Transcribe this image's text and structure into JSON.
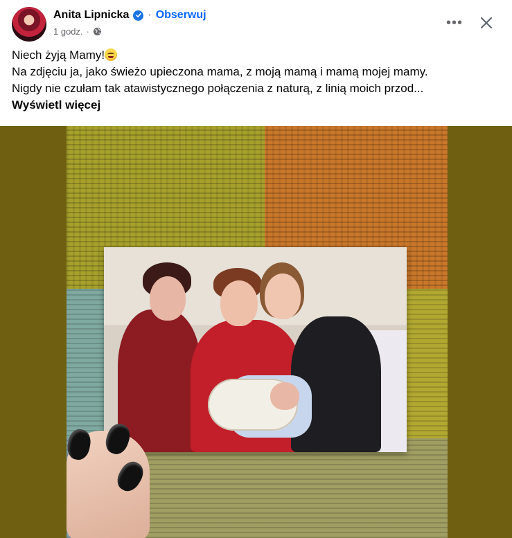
{
  "post": {
    "author": "Anita Lipnicka",
    "separator": "·",
    "follow_label": "Obserwuj",
    "timestamp": "1 godz.",
    "meta_separator": "·",
    "audience_icon": "globe-icon",
    "caption_lines": [
      "Niech żyją Mamy!",
      "Na zdjęciu ja, jako świeżo upieczona mama, z moją mamą i mamą mojej mamy.",
      "Nigdy nie czułam tak atawistycznego połączenia z naturą, z linią moich przod..."
    ],
    "see_more_label": "Wyświetl więcej"
  },
  "colors": {
    "accent_blue": "#0866ff",
    "verified_blue": "#1b74e4",
    "secondary_text": "#65676b",
    "photo_background": "#6f6011"
  }
}
